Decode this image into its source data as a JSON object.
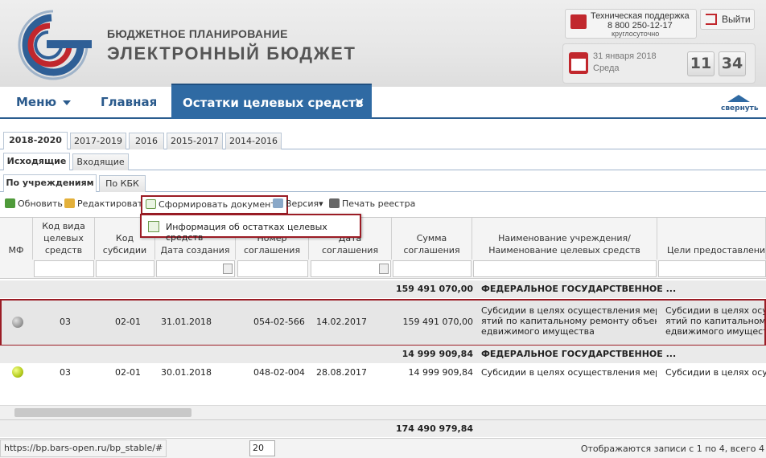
{
  "header": {
    "title_line1": "БЮДЖЕТНОЕ ПЛАНИРОВАНИЕ",
    "title_line2": "ЭЛЕКТРОННЫЙ БЮДЖЕТ",
    "support": {
      "title": "Техническая поддержка",
      "phone": "8 800 250-12-17",
      "hours": "круглосуточно"
    },
    "logout_label": "Выйти",
    "date": "31 января 2018",
    "weekday": "Среда",
    "clock_hours": "11",
    "clock_minutes": "34"
  },
  "nav": {
    "menu_label": "Меню",
    "home_label": "Главная",
    "active_tab_label": "Остатки целевых средств",
    "active_tab_close": "✕",
    "collapse_label": "свернуть"
  },
  "tabs": {
    "years": [
      "2018-2020",
      "2017-2019",
      "2016",
      "2015-2017",
      "2014-2016"
    ],
    "direction": [
      "Исходящие",
      "Входящие"
    ],
    "grouping": [
      "По учреждениям",
      "По КБК"
    ]
  },
  "toolbar": {
    "refresh": "Обновить",
    "edit": "Редактировать",
    "form_document": "Сформировать документ",
    "version": "Версия",
    "print_registry": "Печать реестра",
    "dropdown_item": "Информация об остатках целевых средств"
  },
  "grid": {
    "columns": {
      "mf": "МФ",
      "kind_code": "Код вида\nцелевых\nсредств",
      "subsidy_code": "Код\nсубсидии",
      "created": "Дата создания",
      "agreement_no": "Номер\nсоглашения",
      "agreement_date": "Дата соглашения",
      "amount": "Сумма\nсоглашения",
      "institution": "Наименование учреждения/\nНаименование целевых средств",
      "purpose": "Цели предоставления с"
    },
    "groups": [
      {
        "amount": "159 491 070,00",
        "name": "ФЕДЕРАЛЬНОЕ ГОСУДАРСТВЕННОЕ ..."
      },
      {
        "amount": "14 999 909,84",
        "name": "ФЕДЕРАЛЬНОЕ ГОСУДАРСТВЕННОЕ ..."
      }
    ],
    "rows": [
      {
        "kind_code": "03",
        "subsidy_code": "02-01",
        "created": "31.01.2018",
        "agreement_no": "054-02-566",
        "agreement_date": "14.02.2017",
        "amount": "159 491 070,00",
        "institution": "Субсидии в целях осуществления меропри\nятий по капитальному ремонту объектов н\nедвижимого имущества",
        "purpose": "Субсидии в целях осущ\nятий по капитальному р\nедвижимого имущества",
        "status_color": "#9a9a9a"
      },
      {
        "kind_code": "03",
        "subsidy_code": "02-01",
        "created": "30.01.2018",
        "agreement_no": "048-02-004",
        "agreement_date": "28.08.2017",
        "amount": "14 999 909,84",
        "institution": "Субсидии в целях осуществления мероп...",
        "purpose": "Субсидии в целях осущ",
        "status_color": "#b5cc1e"
      }
    ],
    "total": "174 490 979,84"
  },
  "status": {
    "url": "https://bp.bars-open.ru/bp_stable/#",
    "page_size": "20",
    "records": "Отображаются записи с 1 по 4, всего 4"
  },
  "colors": {
    "accent": "#2f6aa3",
    "highlight_border": "#9b1c25"
  }
}
